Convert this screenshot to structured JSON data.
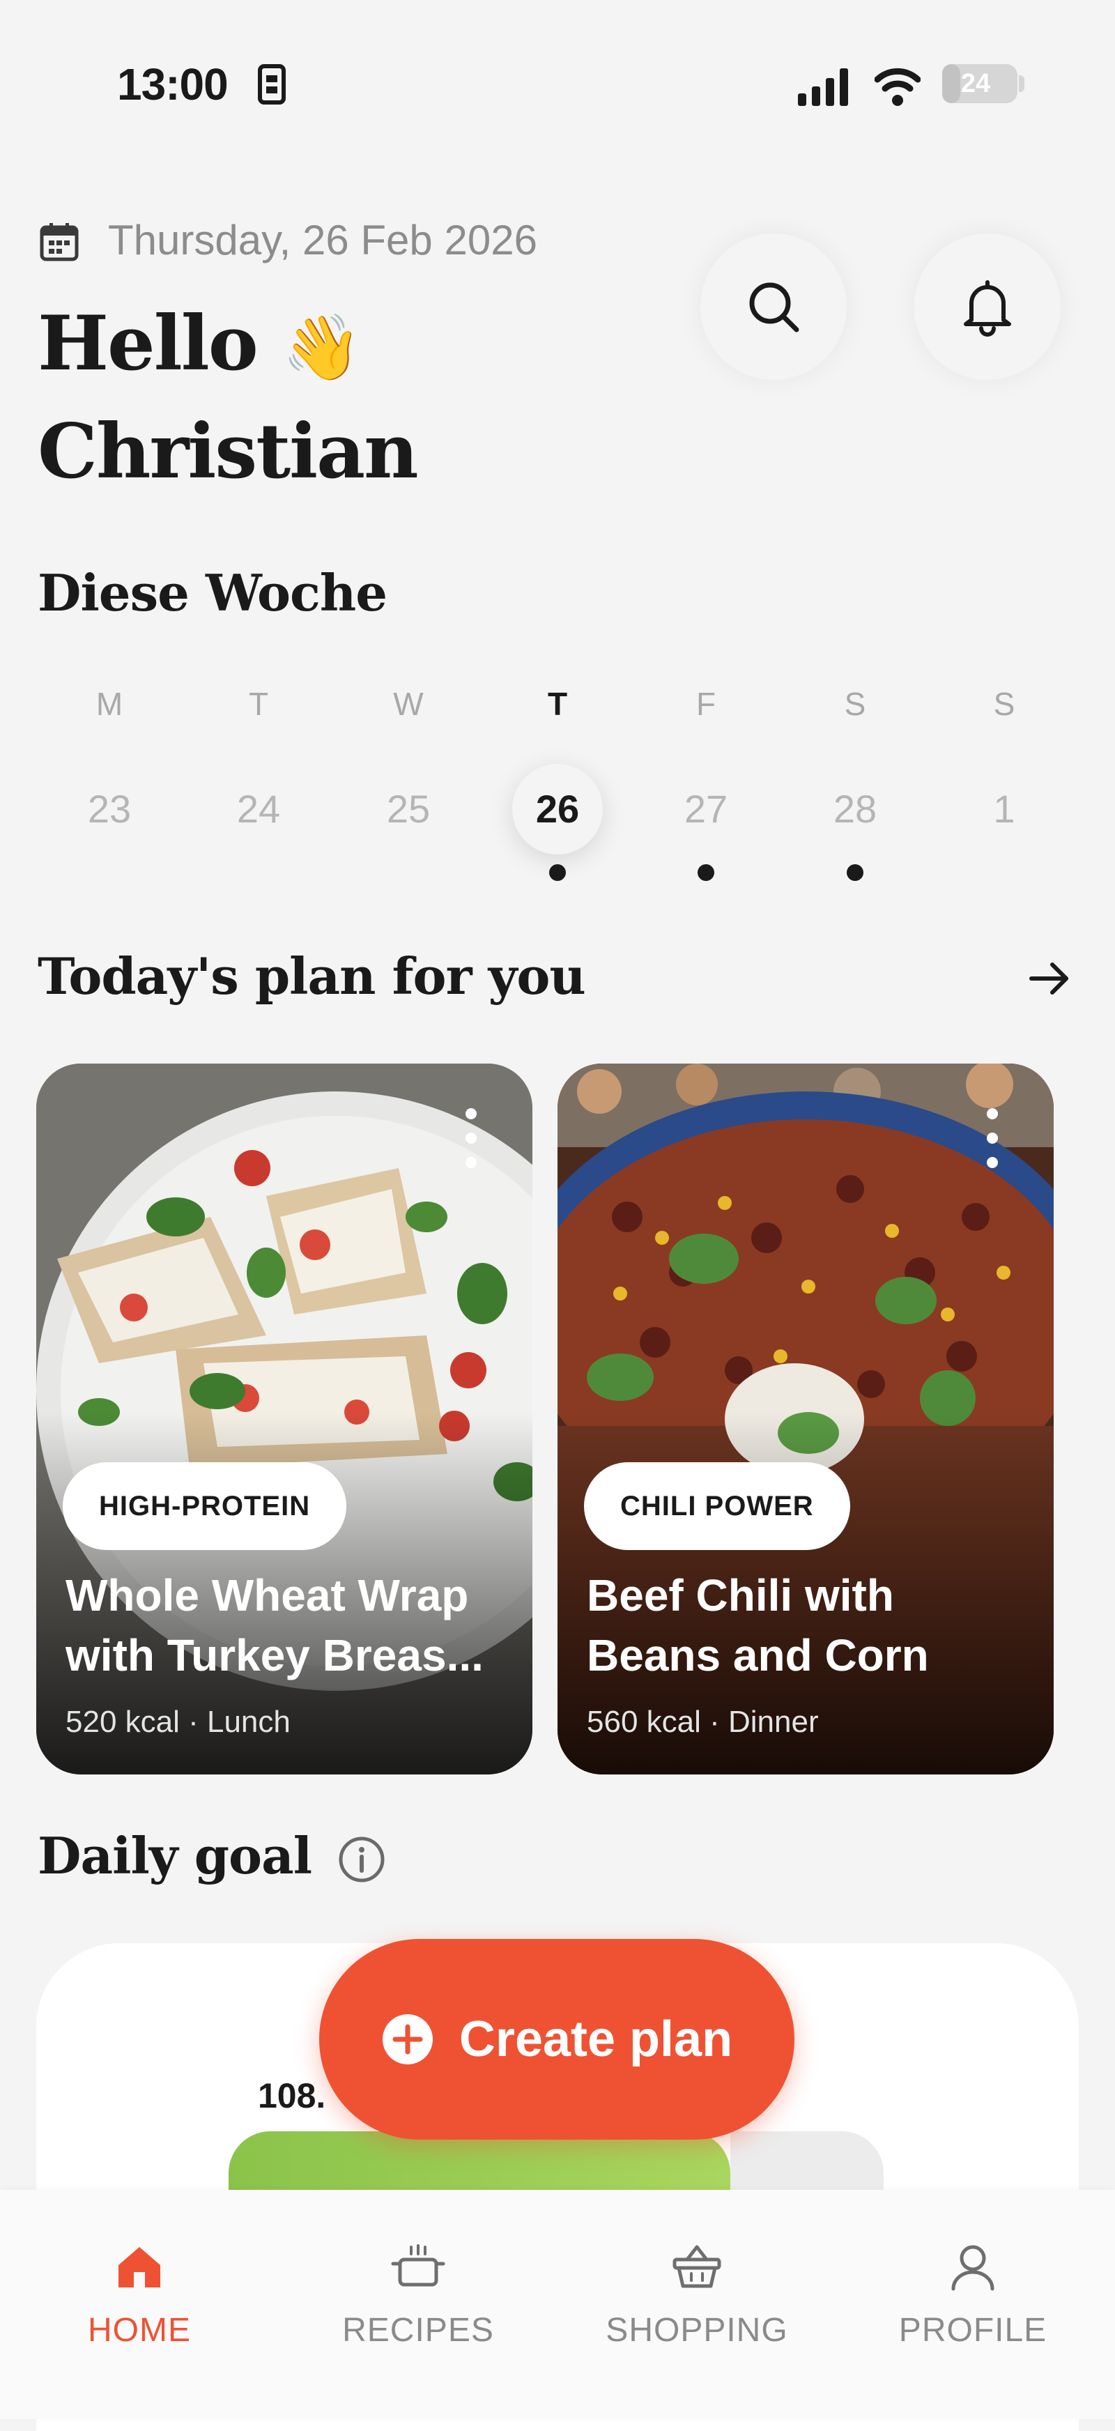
{
  "status_bar": {
    "time": "13:00",
    "battery": "24",
    "battery_level": 0.24
  },
  "header": {
    "date": "Thursday, 26 Feb 2026",
    "greeting_line1": "Hello",
    "greeting_emoji": "👋",
    "greeting_line2": "Christian",
    "icons": [
      "calendar-icon",
      "search-icon",
      "bell-icon"
    ]
  },
  "week": {
    "title": "Diese Woche",
    "days": [
      {
        "letter": "M",
        "date": "23",
        "active": false,
        "has_plan": false
      },
      {
        "letter": "T",
        "date": "24",
        "active": false,
        "has_plan": false
      },
      {
        "letter": "W",
        "date": "25",
        "active": false,
        "has_plan": false
      },
      {
        "letter": "T",
        "date": "26",
        "active": true,
        "has_plan": true
      },
      {
        "letter": "F",
        "date": "27",
        "active": false,
        "has_plan": true
      },
      {
        "letter": "S",
        "date": "28",
        "active": false,
        "has_plan": true
      },
      {
        "letter": "S",
        "date": "1",
        "active": false,
        "has_plan": false
      }
    ]
  },
  "plan": {
    "title": "Today's plan for you",
    "cards": [
      {
        "tag": "HIGH-PROTEIN",
        "title": "Whole Wheat Wrap with Turkey Breas...",
        "meta": "520 kcal · Lunch"
      },
      {
        "tag": "CHILI POWER",
        "title": "Beef Chili with Beans and Corn",
        "meta": "560 kcal · Dinner"
      }
    ]
  },
  "daily_goal": {
    "title": "Daily goal",
    "value": "108.",
    "progress_fraction": 0.77
  },
  "fab": {
    "label": "Create plan"
  },
  "nav": {
    "items": [
      {
        "label": "HOME",
        "icon": "home-icon",
        "active": true
      },
      {
        "label": "RECIPES",
        "icon": "pot-icon",
        "active": false
      },
      {
        "label": "SHOPPING",
        "icon": "basket-icon",
        "active": false
      },
      {
        "label": "PROFILE",
        "icon": "profile-icon",
        "active": false
      }
    ]
  },
  "colors": {
    "accent": "#ef5233",
    "background": "#f4f4f4",
    "text": "#1a1a1a",
    "muted": "#8c8c8c",
    "goal_green": "#8bc34a"
  }
}
